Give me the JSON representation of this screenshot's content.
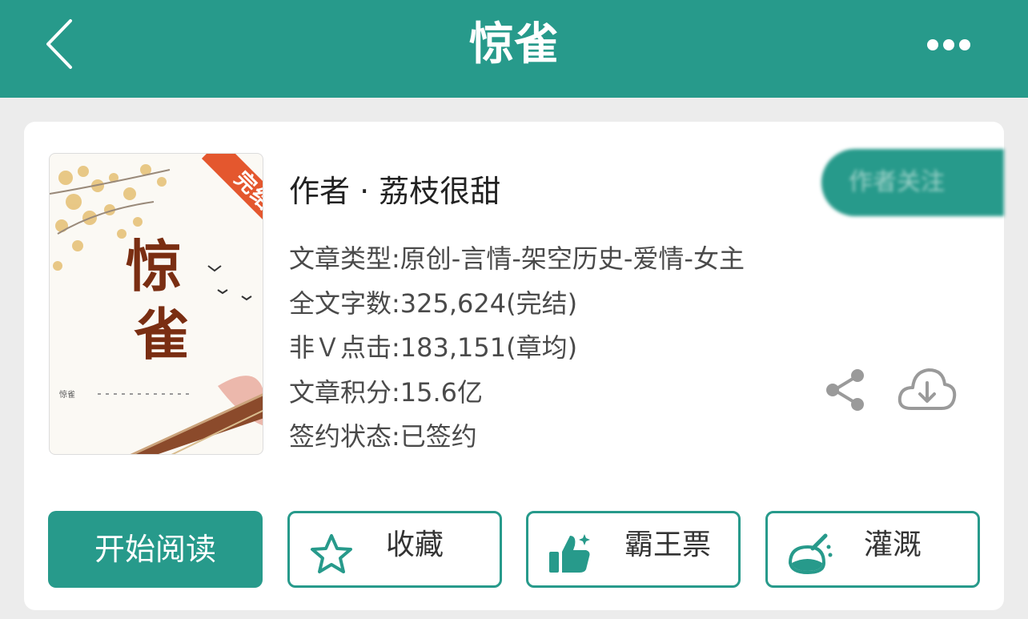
{
  "header": {
    "title": "惊雀"
  },
  "book": {
    "cover_badge": "完结",
    "cover_title": "惊雀",
    "author_line": "作者 · 荔枝很甜",
    "follow_label": "作者关注",
    "meta": [
      "文章类型:原创-言情-架空历史-爱情-女主",
      "全文字数:325,624(完结)",
      "非Ｖ点击:183,151(章均)",
      "文章积分:15.6亿",
      "签约状态:已签约"
    ]
  },
  "actions": {
    "read": "开始阅读",
    "collect": "收藏",
    "vote": "霸王票",
    "water": "灌溉"
  },
  "colors": {
    "primary": "#279a8b",
    "badge": "#e4572e"
  }
}
